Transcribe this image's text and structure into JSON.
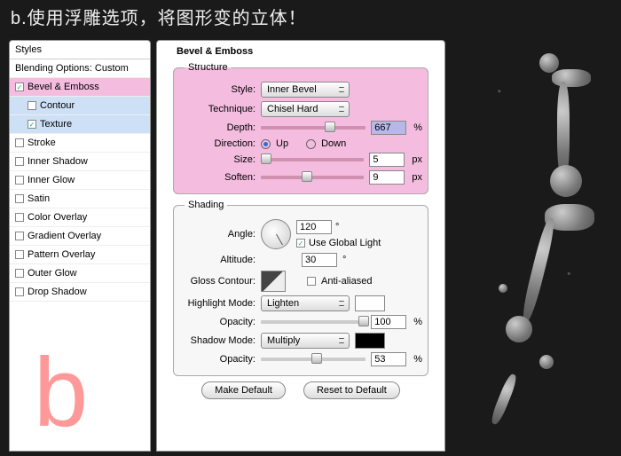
{
  "caption": "b.使用浮雕选项，将图形变的立体！",
  "sidebar": {
    "header": "Styles",
    "blending": "Blending Options: Custom",
    "items": [
      {
        "label": "Bevel & Emboss",
        "checked": true,
        "hi": true
      },
      {
        "label": "Contour",
        "checked": false,
        "sub": true
      },
      {
        "label": "Texture",
        "checked": true,
        "sub": true
      },
      {
        "label": "Stroke",
        "checked": false
      },
      {
        "label": "Inner Shadow",
        "checked": false
      },
      {
        "label": "Inner Glow",
        "checked": false
      },
      {
        "label": "Satin",
        "checked": false
      },
      {
        "label": "Color Overlay",
        "checked": false
      },
      {
        "label": "Gradient Overlay",
        "checked": false
      },
      {
        "label": "Pattern Overlay",
        "checked": false
      },
      {
        "label": "Outer Glow",
        "checked": false
      },
      {
        "label": "Drop Shadow",
        "checked": false
      }
    ]
  },
  "main": {
    "title": "Bevel & Emboss",
    "structure": {
      "legend": "Structure",
      "style_l": "Style:",
      "style_v": "Inner Bevel",
      "tech_l": "Technique:",
      "tech_v": "Chisel Hard",
      "depth_l": "Depth:",
      "depth_v": "667",
      "depth_u": "%",
      "dir_l": "Direction:",
      "up": "Up",
      "down": "Down",
      "size_l": "Size:",
      "size_v": "5",
      "size_u": "px",
      "soft_l": "Soften:",
      "soft_v": "9",
      "soft_u": "px"
    },
    "shading": {
      "legend": "Shading",
      "angle_l": "Angle:",
      "angle_v": "120",
      "global": "Use Global Light",
      "alt_l": "Altitude:",
      "alt_v": "30",
      "gloss_l": "Gloss Contour:",
      "aa": "Anti-aliased",
      "hl_l": "Highlight Mode:",
      "hl_v": "Lighten",
      "hlo_l": "Opacity:",
      "hlo_v": "100",
      "hlo_u": "%",
      "sh_l": "Shadow Mode:",
      "sh_v": "Multiply",
      "sho_l": "Opacity:",
      "sho_v": "53",
      "sho_u": "%"
    },
    "buttons": {
      "def": "Make Default",
      "reset": "Reset to Default"
    }
  },
  "deg": "°"
}
